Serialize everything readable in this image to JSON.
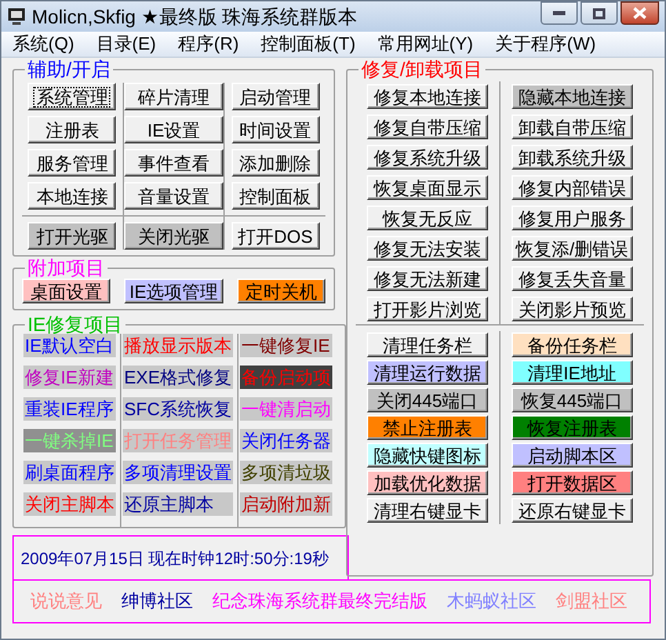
{
  "window": {
    "title": "Molicn,Skfig ★最终版 珠海系统群版本"
  },
  "menu": [
    "系统(Q)",
    "目录(E)",
    "程序(R)",
    "控制面板(T)",
    "常用网址(Y)",
    "关于程序(W)"
  ],
  "assist": {
    "title": "辅助/开启",
    "color": "#0000ff",
    "columns": [
      [
        {
          "label": "系统管理",
          "focused": true
        },
        {
          "label": "注册表",
          "focused": false
        },
        {
          "label": "服务管理",
          "focused": false
        },
        {
          "label": "本地连接",
          "focused": false
        }
      ],
      [
        {
          "label": "碎片清理",
          "focused": false
        },
        {
          "label": "IE设置",
          "focused": false
        },
        {
          "label": "事件查看",
          "focused": false
        },
        {
          "label": "音量设置",
          "focused": false
        }
      ],
      [
        {
          "label": "启动管理",
          "focused": false
        },
        {
          "label": "时间设置",
          "focused": false
        },
        {
          "label": "添加删除",
          "focused": false
        },
        {
          "label": "控制面板",
          "focused": false
        }
      ]
    ],
    "bottom": [
      {
        "label": "打开光驱",
        "focused": false,
        "color": "#c0c0c0"
      },
      {
        "label": "关闭光驱",
        "focused": false,
        "color": "#c0c0c0"
      },
      {
        "label": "打开DOS",
        "focused": false
      }
    ]
  },
  "extra": {
    "title": "附加项目",
    "color": "#ff00ff",
    "buttons": [
      {
        "label": "桌面设置",
        "color": "#ffc0c0"
      },
      {
        "label": "IE选项管理",
        "color": "#c0c0ff"
      },
      {
        "label": "定时关机",
        "color": "#ff8000"
      }
    ]
  },
  "ie_repair": {
    "title": "IE修复项目",
    "color": "#00c000",
    "columns": [
      [
        {
          "label": "IE默认空白",
          "color": "#0000ff",
          "kind": "normal"
        },
        {
          "label": "修复IE新建",
          "color": "#c000c0",
          "kind": "normal"
        },
        {
          "label": "重装IE程序",
          "color": "#0000ff",
          "kind": "normal"
        },
        {
          "label": "一键杀掉IE",
          "color": "#80ff80",
          "kind": "mid"
        },
        {
          "label": "刷桌面程序",
          "color": "#0000ff",
          "kind": "normal"
        },
        {
          "label": "关闭主脚本",
          "color": "#ff0000",
          "kind": "normal"
        }
      ],
      [
        {
          "label": "播放显示版本",
          "color": "#ff0000",
          "kind": "normal"
        },
        {
          "label": "EXE格式修复",
          "color": "#000080",
          "kind": "normal"
        },
        {
          "label": "SFC系统恢复",
          "color": "#0000a0",
          "kind": "normal"
        },
        {
          "label": "打开任务管理",
          "color": "#ff8080",
          "kind": "normal"
        },
        {
          "label": "多项清理设置",
          "color": "#0000ff",
          "kind": "normal"
        },
        {
          "label": "还原主脚本",
          "color": "#0000a0",
          "kind": "normal"
        }
      ],
      [
        {
          "label": "一键修复IE",
          "color": "#800000",
          "kind": "normal"
        },
        {
          "label": "备份启动项",
          "color": "#ff0000",
          "kind": "dark"
        },
        {
          "label": "一键清启动",
          "color": "#ff00ff",
          "kind": "normal"
        },
        {
          "label": "关闭任务器",
          "color": "#0000ff",
          "kind": "normal"
        },
        {
          "label": "多项清垃圾",
          "color": "#404000",
          "kind": "normal"
        },
        {
          "label": "启动附加新",
          "color": "#c00000",
          "kind": "normal"
        }
      ]
    ]
  },
  "clock": "2009年07月15日 现在时钟12时:50分:19秒",
  "repair": {
    "title": "修复/卸载项目",
    "color": "#ff0000",
    "top": [
      {
        "label": "修复本地连接"
      },
      {
        "label": "隐藏本地连接",
        "color": "#c0c0c0"
      },
      {
        "label": "修复自带压缩"
      },
      {
        "label": "卸载自带压缩"
      },
      {
        "label": "修复系统升级"
      },
      {
        "label": "卸载系统升级"
      },
      {
        "label": "恢复桌面显示"
      },
      {
        "label": "修复内部错误"
      },
      {
        "label": "恢复无反应"
      },
      {
        "label": "修复用户服务"
      },
      {
        "label": "修复无法安装"
      },
      {
        "label": "恢复添/删错误"
      },
      {
        "label": "修复无法新建"
      },
      {
        "label": "修复丢失音量"
      },
      {
        "label": "打开影片浏览"
      },
      {
        "label": "关闭影片预览"
      }
    ],
    "bottom": [
      {
        "label": "清理任务栏"
      },
      {
        "label": "备份任务栏",
        "color": "#ffe0c0"
      },
      {
        "label": "清理运行数据",
        "color": "#c0c0ff"
      },
      {
        "label": "清理IE地址",
        "color": "#80ffff"
      },
      {
        "label": "关闭445端口",
        "color": "#c0c0c0"
      },
      {
        "label": "恢复445端口",
        "color": "#c0c0c0"
      },
      {
        "label": "禁止注册表",
        "color": "#ff8000"
      },
      {
        "label": "恢复注册表",
        "color": "#008000"
      },
      {
        "label": "隐藏快键图标",
        "color": "#c0ffff"
      },
      {
        "label": "启动脚本区",
        "color": "#c0c0ff"
      },
      {
        "label": "加载优化数据",
        "color": "#ffc0c0"
      },
      {
        "label": "打开数据区",
        "color": "#ff8080"
      },
      {
        "label": "清理右键显卡"
      },
      {
        "label": "还原右键显卡"
      }
    ]
  },
  "links": [
    {
      "label": "说说意见",
      "color": "#ff8080"
    },
    {
      "label": "绅博社区",
      "color": "#0000a0"
    },
    {
      "label": "纪念珠海系统群最终完结版",
      "color": "#ff00ff"
    },
    {
      "label": "木蚂蚁社区",
      "color": "#8080ff"
    },
    {
      "label": "剑盟社区",
      "color": "#ff8080"
    }
  ]
}
